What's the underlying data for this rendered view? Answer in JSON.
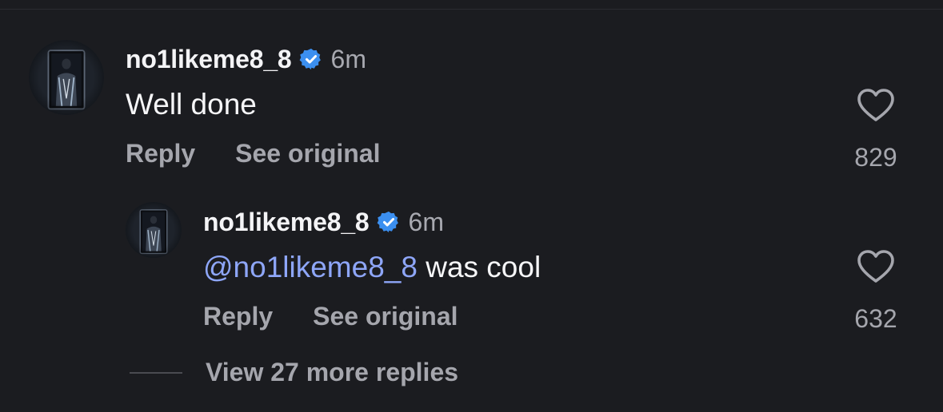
{
  "colors": {
    "background": "#1b1c20",
    "username": "#f4f4f6",
    "secondary_text": "#a5a6ad",
    "mention": "#8ea6f8",
    "verified_badge": "#3b8ff0"
  },
  "comments": [
    {
      "username": "no1likeme8_8",
      "verified": true,
      "time": "6m",
      "text": "Well done",
      "reply_label": "Reply",
      "see_original_label": "See original",
      "like_count": "829",
      "like_icon": "heart-outline-icon"
    }
  ],
  "replies": [
    {
      "username": "no1likeme8_8",
      "verified": true,
      "time": "6m",
      "mention": "@no1likeme8_8",
      "text": " was cool",
      "reply_label": "Reply",
      "see_original_label": "See original",
      "like_count": "632",
      "like_icon": "heart-outline-icon"
    }
  ],
  "view_more_replies": "View 27 more replies"
}
